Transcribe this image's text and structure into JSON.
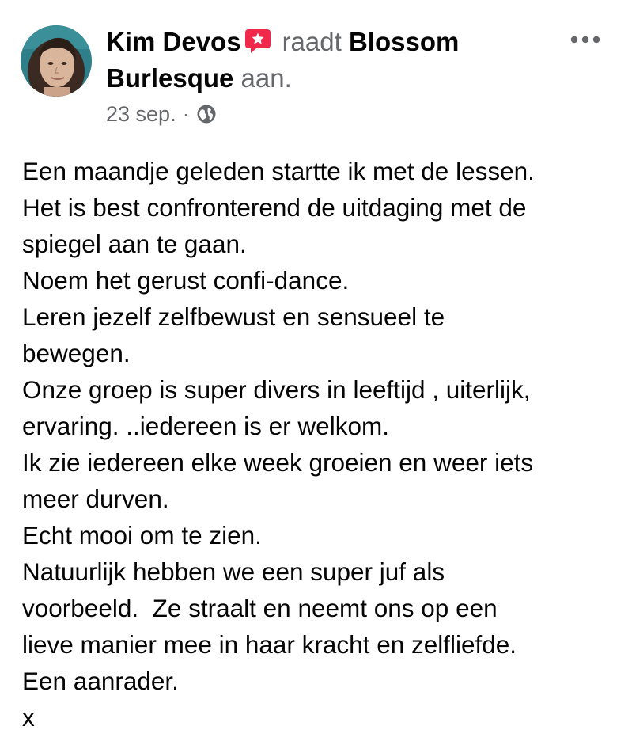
{
  "post": {
    "author": {
      "name": "Kim Devos",
      "avatar_icon": "profile-photo",
      "badge_icon": "recommendation-star-icon"
    },
    "action_text": "raadt",
    "page_name": "Blossom Burlesque",
    "action_suffix": "aan.",
    "date": "23 sep.",
    "separator": "·",
    "audience_icon": "globe-icon",
    "more_icon": "more-options-icon",
    "body_lines": [
      "Een maandje geleden startte ik met de lessen.",
      "Het is best confronterend de uitdaging met de",
      "spiegel aan te gaan.",
      "Noem het gerust confi-dance.",
      "Leren jezelf zelfbewust en sensueel te",
      "bewegen.",
      "Onze groep is super divers in leeftijd , uiterlijk,",
      "ervaring. ..iedereen is er welkom.",
      "Ik zie iedereen elke week groeien en weer iets",
      "meer durven.",
      "Echt mooi om te zien.",
      "Natuurlijk hebben we een super juf als",
      "voorbeeld.  Ze straalt en neemt ons op een",
      "lieve manier mee in haar kracht en zelfliefde.",
      "Een aanrader.",
      "x"
    ]
  },
  "colors": {
    "text_primary": "#050505",
    "text_secondary": "#65676b",
    "badge_red": "#f02849",
    "background": "#ffffff"
  }
}
